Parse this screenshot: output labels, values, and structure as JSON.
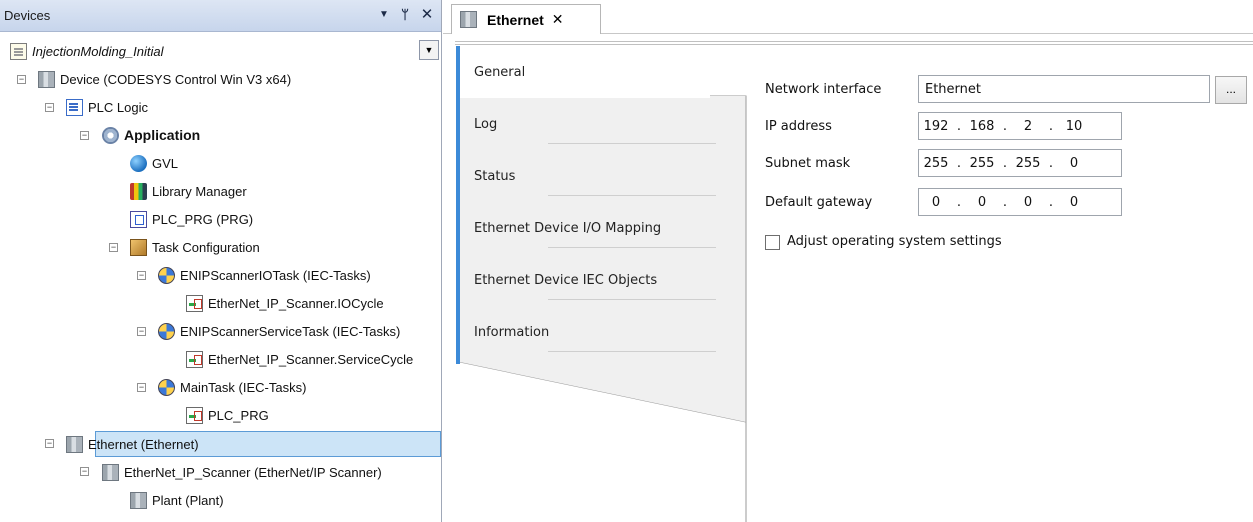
{
  "devices_panel": {
    "title": "Devices",
    "menu_icon": "dropdown-arrow-icon",
    "pin_icon": "pin-icon",
    "close_icon": "close-icon",
    "project_name": "InjectionMolding_Initial",
    "tree": [
      {
        "label": "Device (CODESYS Control Win V3 x64)",
        "icon": "device-icon",
        "level": 0
      },
      {
        "label": "PLC Logic",
        "icon": "plc-logic-icon",
        "level": 1
      },
      {
        "label": "Application",
        "icon": "application-icon",
        "level": 2
      },
      {
        "label": "GVL",
        "icon": "gvl-icon",
        "level": 3
      },
      {
        "label": "Library Manager",
        "icon": "library-manager-icon",
        "level": 3
      },
      {
        "label": "PLC_PRG (PRG)",
        "icon": "pou-icon",
        "level": 3
      },
      {
        "label": "Task Configuration",
        "icon": "task-configuration-icon",
        "level": 3
      },
      {
        "label": "ENIPScannerIOTask (IEC-Tasks)",
        "icon": "task-icon",
        "level": 4
      },
      {
        "label": "EtherNet_IP_Scanner.IOCycle",
        "icon": "program-call-icon",
        "level": 5
      },
      {
        "label": "ENIPScannerServiceTask (IEC-Tasks)",
        "icon": "task-icon",
        "level": 4
      },
      {
        "label": "EtherNet_IP_Scanner.ServiceCycle",
        "icon": "program-call-icon",
        "level": 5
      },
      {
        "label": "MainTask (IEC-Tasks)",
        "icon": "task-icon",
        "level": 4
      },
      {
        "label": "PLC_PRG",
        "icon": "program-call-icon",
        "level": 5
      },
      {
        "label": "Ethernet (Ethernet)",
        "icon": "device-icon",
        "level": 0
      },
      {
        "label": "EtherNet_IP_Scanner (EtherNet/IP Scanner)",
        "icon": "device-icon",
        "level": 1
      },
      {
        "label": "Plant (Plant)",
        "icon": "device-icon",
        "level": 2
      }
    ],
    "selected": "Ethernet (Ethernet)"
  },
  "editor": {
    "tab_label": "Ethernet",
    "tab_icon": "device-icon",
    "tab_close_icon": "close-icon",
    "side_tabs": [
      {
        "label": "General",
        "active": true
      },
      {
        "label": "Log",
        "active": false
      },
      {
        "label": "Status",
        "active": false
      },
      {
        "label": "Ethernet Device I/O Mapping",
        "active": false
      },
      {
        "label": "Ethernet Device IEC Objects",
        "active": false
      },
      {
        "label": "Information",
        "active": false
      }
    ],
    "form": {
      "network_interface_label": "Network interface",
      "network_interface_value": "Ethernet",
      "browse_label": "...",
      "ip_address_label": "IP address",
      "ip_address": [
        "192",
        "168",
        "2",
        "10"
      ],
      "subnet_mask_label": "Subnet mask",
      "subnet_mask": [
        "255",
        "255",
        "255",
        "0"
      ],
      "default_gateway_label": "Default gateway",
      "default_gateway": [
        "0",
        "0",
        "0",
        "0"
      ],
      "ip_separator": ".",
      "adjust_os_label": "Adjust operating system settings",
      "adjust_os_checked": false
    }
  },
  "colors": {
    "selection": "#cce4f7",
    "active_tab_accent": "#3c8ad8",
    "titlebar": "#c7d5ec"
  }
}
